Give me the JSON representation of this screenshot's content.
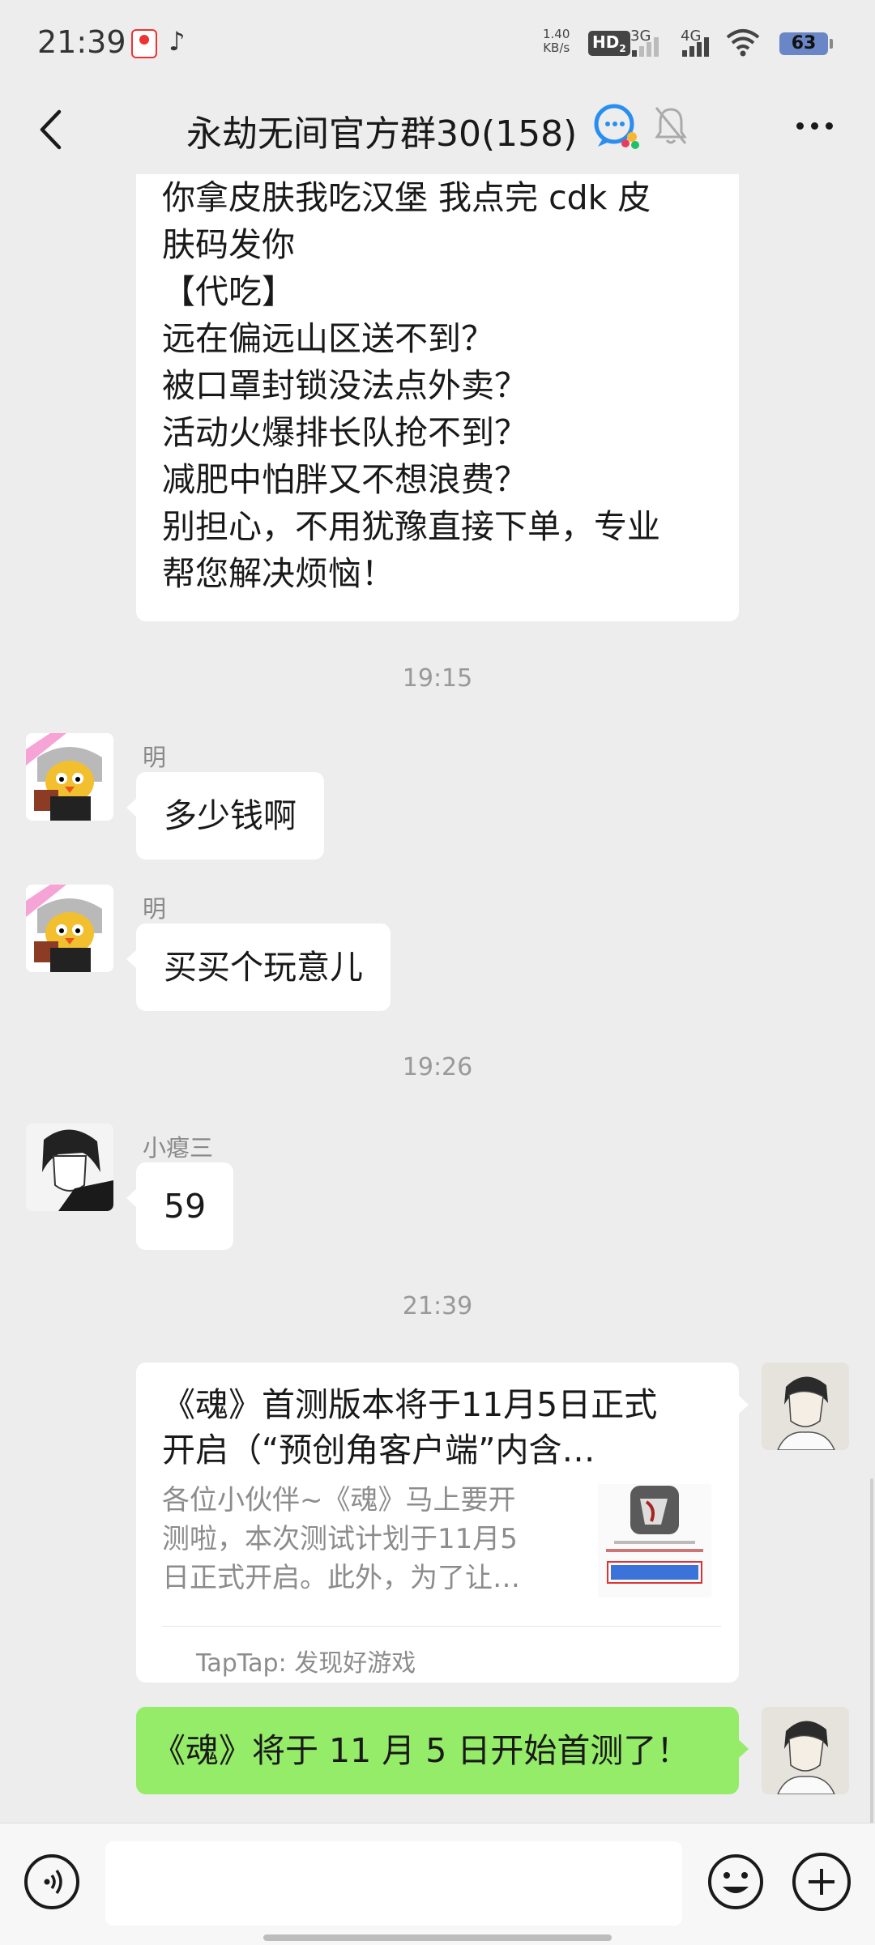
{
  "status_bar": {
    "time": "21:39",
    "net_speed_top": "1.40",
    "net_speed_bottom": "KB/s",
    "hd_label": "HD",
    "hd_sub": "2",
    "net1": "3G",
    "net2": "4G",
    "battery": "63"
  },
  "nav": {
    "title": "永劫无间官方群30(158)"
  },
  "messages": {
    "long_text": {
      "lines": [
        "你拿皮肤我吃汉堡 我点完 cdk 皮",
        "肤码发你",
        "【代吃】",
        "远在偏远山区送不到？",
        "被口罩封锁没法点外卖？",
        "活动火爆排长队抢不到？",
        "减肥中怕胖又不想浪费？",
        "别担心，不用犹豫直接下单，专业",
        "帮您解决烦恼！"
      ]
    },
    "time1": "19:15",
    "m1": {
      "sender": "明",
      "text": "多少钱啊"
    },
    "m2": {
      "sender": "明",
      "text": "买买个玩意儿"
    },
    "time2": "19:26",
    "m3": {
      "sender": "小瘪三",
      "text": "59"
    },
    "time3": "21:39",
    "card": {
      "title_line1": "《魂》首测版本将于11月5日正式",
      "title_line2": "开启（“预创角客户端”内含…",
      "desc_line1": "各位小伙伴~《魂》马上要开",
      "desc_line2": "测啦，本次测试计划于11月5",
      "desc_line3": "日正式开启。此外，为了让…",
      "source": "TapTap: 发现好游戏"
    },
    "m4": {
      "text": "《魂》将于 11 月 5 日开始首测了！"
    }
  },
  "input": {
    "placeholder": ""
  },
  "colors": {
    "background": "#ededed",
    "self_bubble": "#95ec69",
    "other_bubble": "#ffffff",
    "time_text": "#999999"
  }
}
